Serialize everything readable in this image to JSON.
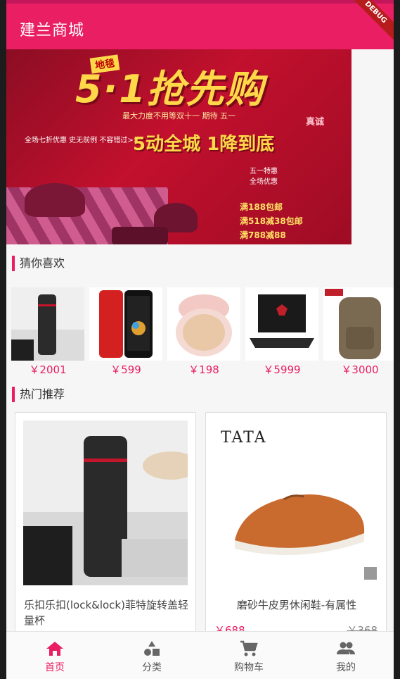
{
  "appbar": {
    "title": "建兰商城",
    "debug_ribbon": "DEBUG"
  },
  "banner": {
    "tag": "地毯",
    "headline": "5·1抢先购",
    "sub": "最大力度不用等双十一 期待 五一",
    "left_promo": "全场七折优惠 史无前例 不容错过>>",
    "big": "5动全城 1降到底",
    "side": [
      "五一特惠",
      "全场优惠"
    ],
    "deals": [
      "满188包邮",
      "满518减38包邮",
      "满788减88"
    ],
    "stand": "真诚",
    "dots_count": 4,
    "active_dot": 0
  },
  "like_section": {
    "title": "猜你喜欢",
    "items": [
      {
        "image": "thermos-bottle",
        "price": "￥2001"
      },
      {
        "image": "red-smartphone",
        "price": "￥599"
      },
      {
        "image": "cushion-compact",
        "price": "￥198"
      },
      {
        "image": "gaming-laptop",
        "price": "￥5999"
      },
      {
        "image": "tumi-backpack",
        "price": "￥3000"
      }
    ]
  },
  "hot_section": {
    "title": "热门推荐",
    "items": [
      {
        "image": "thermos-bottle",
        "name": "乐扣乐扣(lock&lock)菲特旋转盖轻量杯",
        "price": "",
        "old_price": ""
      },
      {
        "image": "leather-shoe",
        "brand": "TATA",
        "name": "磨砂牛皮男休闲鞋-有属性",
        "price": "￥688",
        "old_price": "￥368"
      }
    ]
  },
  "bottom_nav": {
    "active": 0,
    "items": [
      {
        "label": "首页",
        "icon": "home-icon"
      },
      {
        "label": "分类",
        "icon": "category-icon"
      },
      {
        "label": "购物车",
        "icon": "cart-icon"
      },
      {
        "label": "我的",
        "icon": "people-icon"
      }
    ]
  },
  "colors": {
    "primary": "#e91e63",
    "primary_dark": "#c2185b",
    "background": "#f6f6f6"
  }
}
